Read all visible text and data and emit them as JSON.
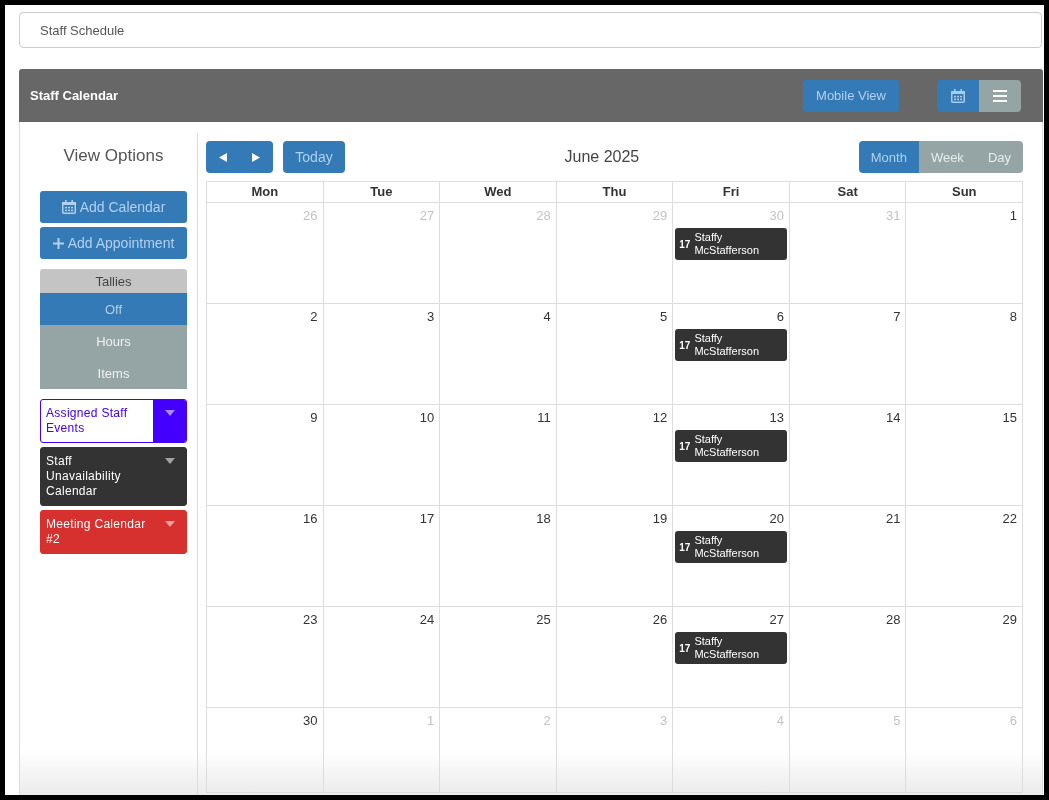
{
  "page_title": "Staff Schedule",
  "panel": {
    "title": "Staff Calendar",
    "mobile_button": "Mobile View",
    "view_toggle": [
      {
        "selected": true
      },
      {
        "selected": false
      }
    ]
  },
  "sidebar": {
    "heading": "View Options",
    "add_calendar_button": "Add Calendar",
    "add_appointment_button": "Add Appointment",
    "tallies": {
      "title": "Tallies",
      "options": [
        {
          "label": "Off",
          "selected": true
        },
        {
          "label": "Hours",
          "selected": false
        },
        {
          "label": "Items",
          "selected": false
        }
      ]
    },
    "calendars": [
      {
        "name": "Assigned Staff Events",
        "color": "#4400ff",
        "selected": true
      },
      {
        "name": "Staff Unavailability Calendar",
        "color": "#333333",
        "selected": false
      },
      {
        "name": "Meeting Calendar #2",
        "color": "#d6302f",
        "selected": false
      }
    ]
  },
  "calendar": {
    "today_button": "Today",
    "title": "June 2025",
    "views": [
      {
        "label": "Month",
        "selected": true
      },
      {
        "label": "Week",
        "selected": false
      },
      {
        "label": "Day",
        "selected": false
      }
    ],
    "weekdays": [
      "Mon",
      "Tue",
      "Wed",
      "Thu",
      "Fri",
      "Sat",
      "Sun"
    ],
    "weeks": [
      {
        "days": [
          {
            "date": "26",
            "in_month": false
          },
          {
            "date": "27",
            "in_month": false
          },
          {
            "date": "28",
            "in_month": false
          },
          {
            "date": "29",
            "in_month": false
          },
          {
            "date": "30",
            "in_month": false,
            "events": [
              {
                "tag": "17",
                "title": "Staffy McStafferson"
              }
            ]
          },
          {
            "date": "31",
            "in_month": false
          },
          {
            "date": "1",
            "in_month": true
          }
        ]
      },
      {
        "days": [
          {
            "date": "2",
            "in_month": true
          },
          {
            "date": "3",
            "in_month": true
          },
          {
            "date": "4",
            "in_month": true
          },
          {
            "date": "5",
            "in_month": true
          },
          {
            "date": "6",
            "in_month": true,
            "events": [
              {
                "tag": "17",
                "title": "Staffy McStafferson"
              }
            ]
          },
          {
            "date": "7",
            "in_month": true
          },
          {
            "date": "8",
            "in_month": true
          }
        ]
      },
      {
        "days": [
          {
            "date": "9",
            "in_month": true
          },
          {
            "date": "10",
            "in_month": true
          },
          {
            "date": "11",
            "in_month": true
          },
          {
            "date": "12",
            "in_month": true
          },
          {
            "date": "13",
            "in_month": true,
            "events": [
              {
                "tag": "17",
                "title": "Staffy McStafferson"
              }
            ]
          },
          {
            "date": "14",
            "in_month": true
          },
          {
            "date": "15",
            "in_month": true
          }
        ]
      },
      {
        "days": [
          {
            "date": "16",
            "in_month": true
          },
          {
            "date": "17",
            "in_month": true
          },
          {
            "date": "18",
            "in_month": true
          },
          {
            "date": "19",
            "in_month": true
          },
          {
            "date": "20",
            "in_month": true,
            "events": [
              {
                "tag": "17",
                "title": "Staffy McStafferson"
              }
            ]
          },
          {
            "date": "21",
            "in_month": true
          },
          {
            "date": "22",
            "in_month": true
          }
        ]
      },
      {
        "days": [
          {
            "date": "23",
            "in_month": true
          },
          {
            "date": "24",
            "in_month": true
          },
          {
            "date": "25",
            "in_month": true
          },
          {
            "date": "26",
            "in_month": true
          },
          {
            "date": "27",
            "in_month": true,
            "events": [
              {
                "tag": "17",
                "title": "Staffy McStafferson"
              }
            ]
          },
          {
            "date": "28",
            "in_month": true
          },
          {
            "date": "29",
            "in_month": true
          }
        ]
      },
      {
        "days": [
          {
            "date": "30",
            "in_month": true
          },
          {
            "date": "1",
            "in_month": false
          },
          {
            "date": "2",
            "in_month": false
          },
          {
            "date": "3",
            "in_month": false
          },
          {
            "date": "4",
            "in_month": false
          },
          {
            "date": "5",
            "in_month": false
          },
          {
            "date": "6",
            "in_month": false
          }
        ]
      }
    ]
  }
}
